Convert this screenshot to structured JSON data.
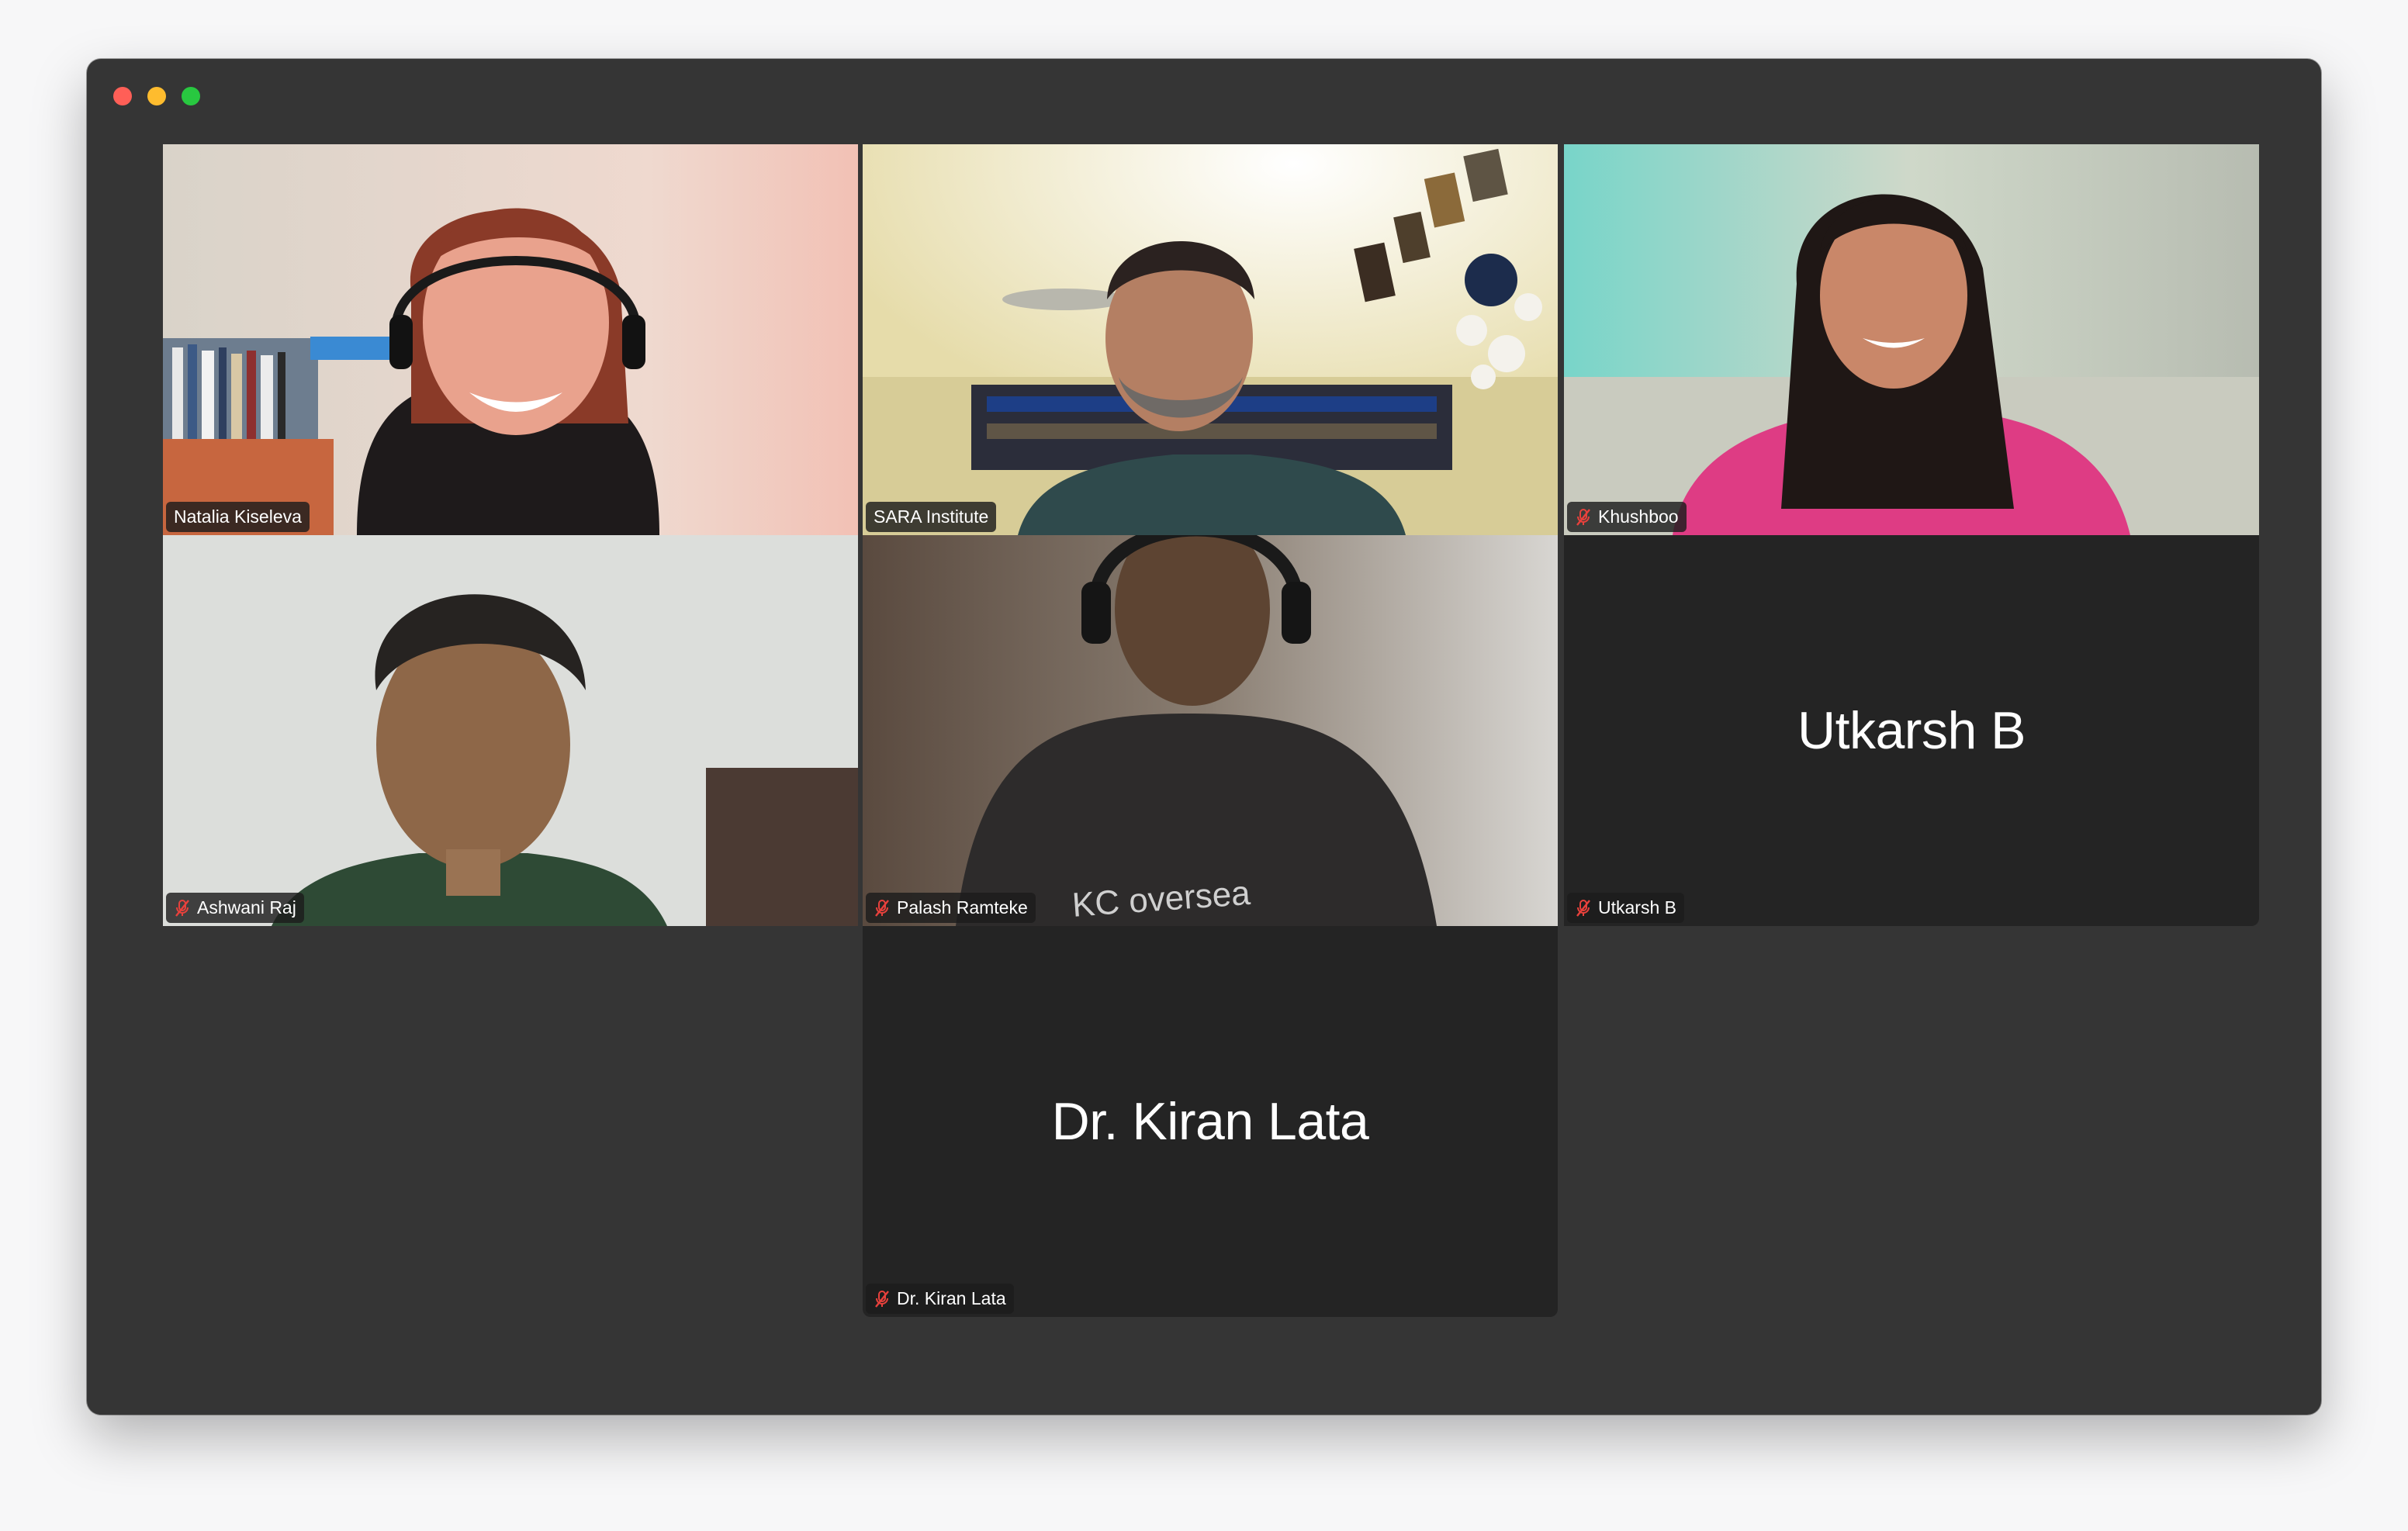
{
  "window": {
    "traffic_lights": [
      "close",
      "minimize",
      "zoom"
    ]
  },
  "colors": {
    "background": "#353535",
    "tile_empty": "#242424",
    "speaking_border": "#2fc74b",
    "mute": "#e8413c"
  },
  "participants": [
    {
      "name": "Natalia Kiseleva",
      "muted": false,
      "video": true,
      "speaking": false
    },
    {
      "name": "SARA Institute",
      "muted": false,
      "video": true,
      "speaking": true
    },
    {
      "name": "Khushboo",
      "muted": true,
      "video": true,
      "speaking": false
    },
    {
      "name": "Ashwani Raj",
      "muted": true,
      "video": true,
      "speaking": false
    },
    {
      "name": "Palash Ramteke",
      "muted": true,
      "video": true,
      "speaking": false
    },
    {
      "name": "Utkarsh B",
      "muted": true,
      "video": false,
      "speaking": false,
      "display_name": "Utkarsh B"
    },
    {
      "name": "Dr. Kiran Lata",
      "muted": true,
      "video": false,
      "speaking": false,
      "display_name": "Dr. Kiran Lata"
    }
  ],
  "shirt_text": "KC oversea"
}
